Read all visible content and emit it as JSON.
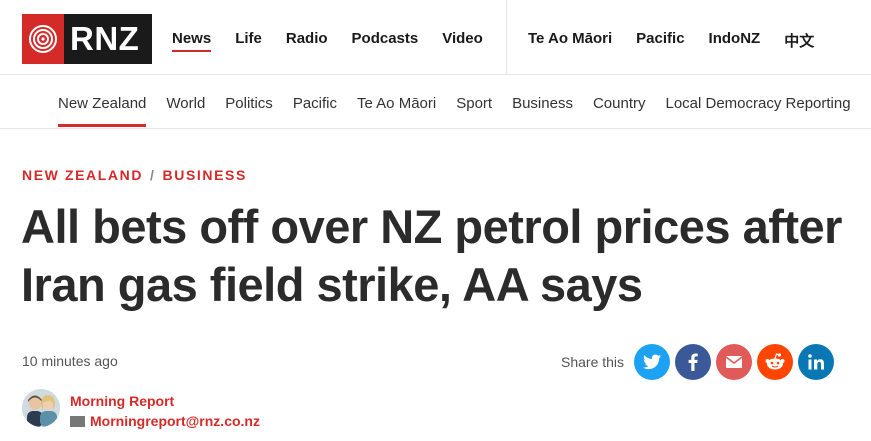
{
  "header": {
    "logo_text": "RNZ",
    "primary_nav": [
      "News",
      "Life",
      "Radio",
      "Podcasts",
      "Video"
    ],
    "active_primary": "News",
    "secondary_nav": [
      "Te Ao Māori",
      "Pacific",
      "IndoNZ",
      "中文"
    ]
  },
  "section_nav": {
    "items": [
      "New Zealand",
      "World",
      "Politics",
      "Pacific",
      "Te Ao Māori",
      "Sport",
      "Business",
      "Country",
      "Local Democracy Reporting"
    ],
    "active": "New Zealand"
  },
  "article": {
    "breadcrumb": [
      "NEW ZEALAND",
      "BUSINESS"
    ],
    "breadcrumb_sep": "/",
    "headline": "All bets off over NZ petrol prices after Iran gas field strike, AA says",
    "timestamp": "10 minutes ago"
  },
  "share": {
    "label": "Share this",
    "buttons": [
      {
        "name": "twitter",
        "icon": "twitter-icon",
        "color": "#1da1f2"
      },
      {
        "name": "facebook",
        "icon": "facebook-icon",
        "color": "#3b5998"
      },
      {
        "name": "email",
        "icon": "email-icon",
        "color": "#e05a5a"
      },
      {
        "name": "reddit",
        "icon": "reddit-icon",
        "color": "#ff4500"
      },
      {
        "name": "linkedin",
        "icon": "linkedin-icon",
        "color": "#0a77b5"
      }
    ]
  },
  "author": {
    "name": "Morning Report",
    "email": "Morningreport@rnz.co.nz"
  },
  "colors": {
    "brand_red": "#d42a28",
    "text_dark": "#2b2b2b"
  }
}
